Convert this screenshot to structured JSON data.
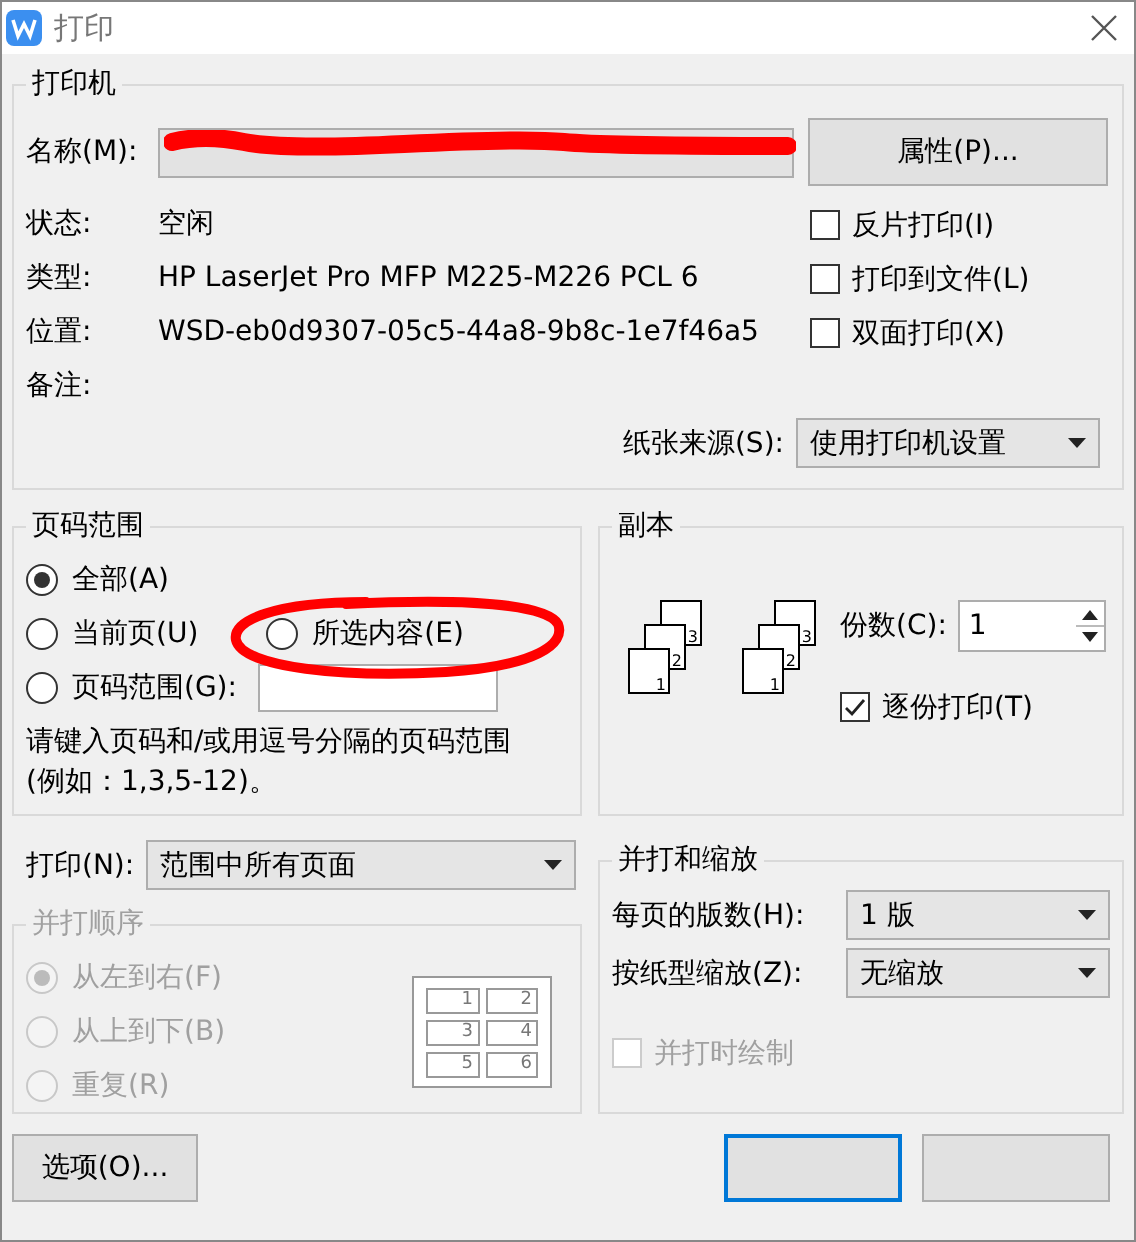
{
  "window": {
    "title": "打印"
  },
  "printer": {
    "title": "打印机",
    "name_label": "名称(M):",
    "properties_button": "属性(P)...",
    "info": [
      {
        "label": "状态:",
        "value": "空闲"
      },
      {
        "label": "类型:",
        "value": "HP LaserJet Pro MFP M225-M226 PCL 6"
      },
      {
        "label": "位置:",
        "value": "WSD-eb0d9307-05c5-44a8-9b8c-1e7f46a5"
      },
      {
        "label": "备注:"
      }
    ],
    "options": [
      {
        "label": "反片打印(I)",
        "checked": false
      },
      {
        "label": "打印到文件(L)",
        "checked": false
      },
      {
        "label": "双面打印(X)",
        "checked": false
      }
    ],
    "paper_source": {
      "label": "纸张来源(S):",
      "value": "使用打印机设置"
    }
  },
  "page_range": {
    "title": "页码范围",
    "options": [
      {
        "label": "全部(A)",
        "selected": true
      },
      {
        "label": "当前页(U)",
        "selected": false
      },
      {
        "label": "所选内容(E)",
        "selected": false
      },
      {
        "label": "页码范围(G):",
        "selected": false
      }
    ],
    "hint": "请键入页码和/或用逗号分隔的页码范围\n(例如：1,3,5-12)。"
  },
  "copies": {
    "title": "副本",
    "stacks": [
      [
        "1",
        "2",
        "3"
      ],
      [
        "1",
        "2",
        "3"
      ]
    ],
    "count_label": "份数(C):",
    "count": "1",
    "collate": {
      "label": "逐份打印(T)",
      "checked": true
    }
  },
  "print_what": {
    "label": "打印(N):",
    "value": "范围中所有页面"
  },
  "collate_order": {
    "title": "并打顺序",
    "disabled": true,
    "options": [
      {
        "label": "从左到右(F)",
        "selected": true
      },
      {
        "label": "从上到下(B)",
        "selected": false
      },
      {
        "label": "重复(R)",
        "selected": false
      }
    ],
    "preview_pages": [
      "1",
      "2",
      "3",
      "4",
      "5",
      "6"
    ]
  },
  "scaling": {
    "title": "并打和缩放",
    "pages_per_sheet": {
      "label": "每页的版数(H):",
      "value": "1 版"
    },
    "scale": {
      "label": "按纸型缩放(Z):",
      "value": "无缩放"
    },
    "draw_borders": {
      "label": "并打时绘制",
      "checked": false,
      "disabled": true
    }
  },
  "buttons": [
    {
      "kind": "options",
      "label": "选项(O)..."
    },
    {
      "kind": "default"
    },
    {
      "kind": "normal"
    }
  ],
  "annotations": [
    {
      "kind": "scribble"
    },
    {
      "kind": "circle"
    }
  ]
}
